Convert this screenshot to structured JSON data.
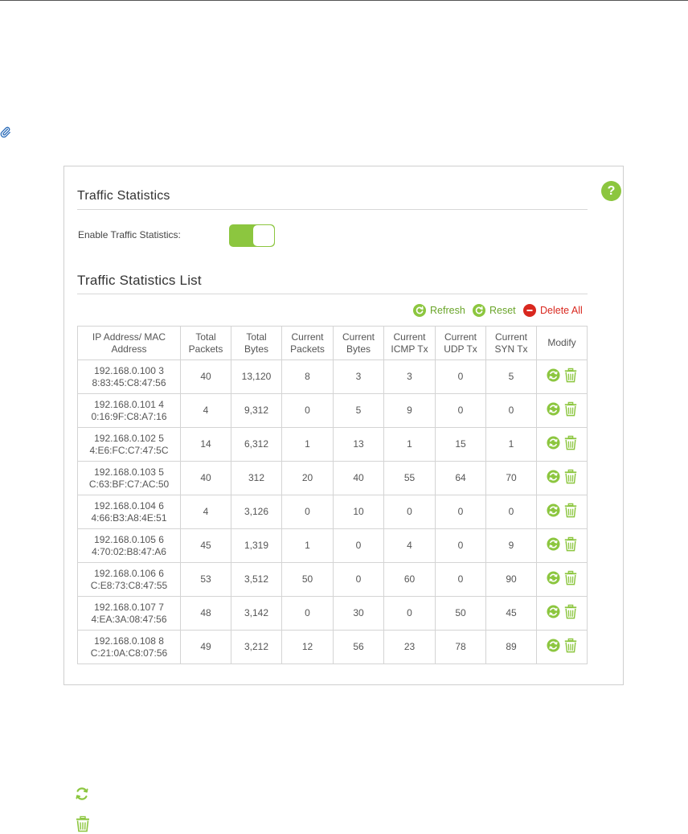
{
  "panel": {
    "help_glyph": "?",
    "section1_title": "Traffic Statistics",
    "enable_label": "Enable Traffic Statistics:",
    "enable_state": "on",
    "section2_title": "Traffic Statistics List"
  },
  "actions": {
    "refresh": "Refresh",
    "reset": "Reset",
    "delete_all": "Delete All"
  },
  "colors": {
    "accent_green": "#8cc63f",
    "link_green": "#6aa52a",
    "danger_red": "#d9281f"
  },
  "table": {
    "headers": [
      [
        "IP Address/ MAC",
        "Address"
      ],
      [
        "Total",
        "Packets"
      ],
      [
        "Total",
        "Bytes"
      ],
      [
        "Current",
        "Packets"
      ],
      [
        "Current",
        "Bytes"
      ],
      [
        "Current",
        "ICMP Tx"
      ],
      [
        "Current",
        "UDP Tx"
      ],
      [
        "Current",
        "SYN Tx"
      ],
      [
        "Modify"
      ]
    ],
    "rows": [
      {
        "addr1": "192.168.0.100 3",
        "addr2": "8:83:45:C8:47:56",
        "total_packets": "40",
        "total_bytes": "13,120",
        "cur_packets": "8",
        "cur_bytes": "3",
        "icmp": "3",
        "udp": "0",
        "syn": "5"
      },
      {
        "addr1": "192.168.0.101 4",
        "addr2": "0:16:9F:C8:A7:16",
        "total_packets": "4",
        "total_bytes": "9,312",
        "cur_packets": "0",
        "cur_bytes": "5",
        "icmp": "9",
        "udp": "0",
        "syn": "0"
      },
      {
        "addr1": "192.168.0.102 5",
        "addr2": "4:E6:FC:C7:47:5C",
        "total_packets": "14",
        "total_bytes": "6,312",
        "cur_packets": "1",
        "cur_bytes": "13",
        "icmp": "1",
        "udp": "15",
        "syn": "1"
      },
      {
        "addr1": "192.168.0.103 5",
        "addr2": "C:63:BF:C7:AC:50",
        "total_packets": "40",
        "total_bytes": "312",
        "cur_packets": "20",
        "cur_bytes": "40",
        "icmp": "55",
        "udp": "64",
        "syn": "70"
      },
      {
        "addr1": "192.168.0.104 6",
        "addr2": "4:66:B3:A8:4E:51",
        "total_packets": "4",
        "total_bytes": "3,126",
        "cur_packets": "0",
        "cur_bytes": "10",
        "icmp": "0",
        "udp": "0",
        "syn": "0"
      },
      {
        "addr1": "192.168.0.105 6",
        "addr2": "4:70:02:B8:47:A6",
        "total_packets": "45",
        "total_bytes": "1,319",
        "cur_packets": "1",
        "cur_bytes": "0",
        "icmp": "4",
        "udp": "0",
        "syn": "9"
      },
      {
        "addr1": "192.168.0.106 6",
        "addr2": "C:E8:73:C8:47:55",
        "total_packets": "53",
        "total_bytes": "3,512",
        "cur_packets": "50",
        "cur_bytes": "0",
        "icmp": "60",
        "udp": "0",
        "syn": "90"
      },
      {
        "addr1": "192.168.0.107 7",
        "addr2": "4:EA:3A:08:47:56",
        "total_packets": "48",
        "total_bytes": "3,142",
        "cur_packets": "0",
        "cur_bytes": "30",
        "icmp": "0",
        "udp": "50",
        "syn": "45"
      },
      {
        "addr1": "192.168.0.108 8",
        "addr2": "C:21:0A:C8:07:56",
        "total_packets": "49",
        "total_bytes": "3,212",
        "cur_packets": "12",
        "cur_bytes": "56",
        "icmp": "23",
        "udp": "78",
        "syn": "89"
      }
    ]
  },
  "icons": {
    "attachment": "paperclip-icon",
    "refresh_row": "refresh-icon",
    "delete_row": "trash-icon",
    "legend_refresh": "refresh-icon",
    "legend_delete": "trash-icon"
  }
}
